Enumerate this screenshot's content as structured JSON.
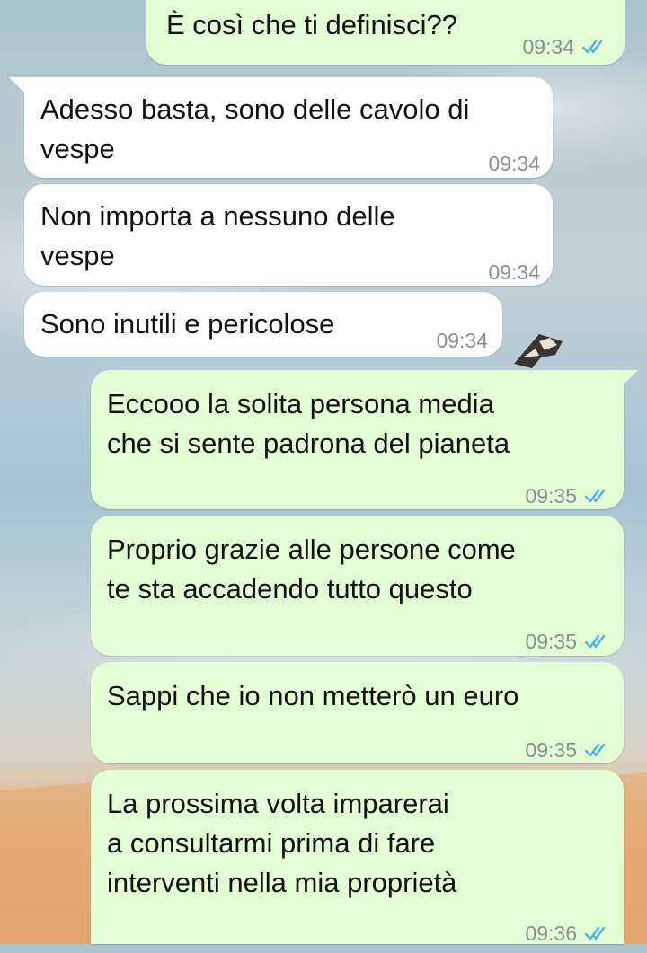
{
  "theme": {
    "outgoing_bubble": "#e3fdd4",
    "incoming_bubble": "#ffffff",
    "read_tick_color": "#4fb3ea"
  },
  "messages": [
    {
      "direction": "outgoing",
      "text": "È così che ti definisci??",
      "time": "09:34",
      "status_icon": "double-check-read-icon"
    },
    {
      "direction": "incoming",
      "text": "Adesso basta, sono delle cavolo di\nvespe",
      "time": "09:34"
    },
    {
      "direction": "incoming",
      "text": "Non importa a nessuno delle\nvespe",
      "time": "09:34"
    },
    {
      "direction": "incoming",
      "text": "Sono inutili e pericolose",
      "time": "09:34"
    },
    {
      "direction": "outgoing",
      "text": "Eccooo la solita persona media\nche si sente padrona del pianeta",
      "time": "09:35",
      "status_icon": "double-check-read-icon"
    },
    {
      "direction": "outgoing",
      "text": "Proprio grazie alle persone come\nte sta accadendo tutto questo",
      "time": "09:35",
      "status_icon": "double-check-read-icon"
    },
    {
      "direction": "outgoing",
      "text": "Sappi che io non metterò un euro",
      "time": "09:35",
      "status_icon": "double-check-read-icon"
    },
    {
      "direction": "outgoing",
      "text": "La prossima volta imparerai\na consultarmi prima di fare\ninterventi nella mia proprietà",
      "time": "09:36",
      "status_icon": "double-check-read-icon"
    }
  ]
}
